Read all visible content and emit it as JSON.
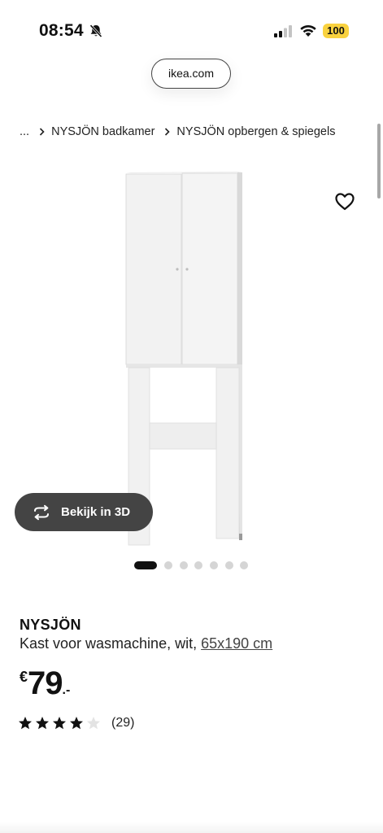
{
  "status_bar": {
    "time": "08:54",
    "battery": "100",
    "battery_color": "#f9d23f",
    "icons": [
      "bell-muted-icon",
      "cellular-signal-icon",
      "wifi-icon",
      "battery-icon"
    ]
  },
  "browser": {
    "url": "ikea.com"
  },
  "breadcrumb": {
    "ellipsis": "...",
    "items": [
      "NYSJÖN badkamer",
      "NYSJÖN opbergen & spiegels"
    ]
  },
  "product": {
    "brand": "NYSJÖN",
    "description": "Kast voor wasmachine, wit,",
    "measure": "65x190 cm",
    "price": {
      "currency": "€",
      "integer": "79",
      "decimal": ".-"
    },
    "rating": {
      "stars": 4,
      "max_stars": 5,
      "count": "(29)"
    },
    "wishlist_icon": "heart-outline-icon"
  },
  "gallery": {
    "view_3d_label": "Bekijk in 3D",
    "view_3d_icon": "rotate-3d-icon",
    "total_images": 7,
    "active_index": 0
  },
  "colors": {
    "dark_button": "#444444",
    "active_dot": "#111111",
    "inactive_dot": "#d5d5d5"
  }
}
